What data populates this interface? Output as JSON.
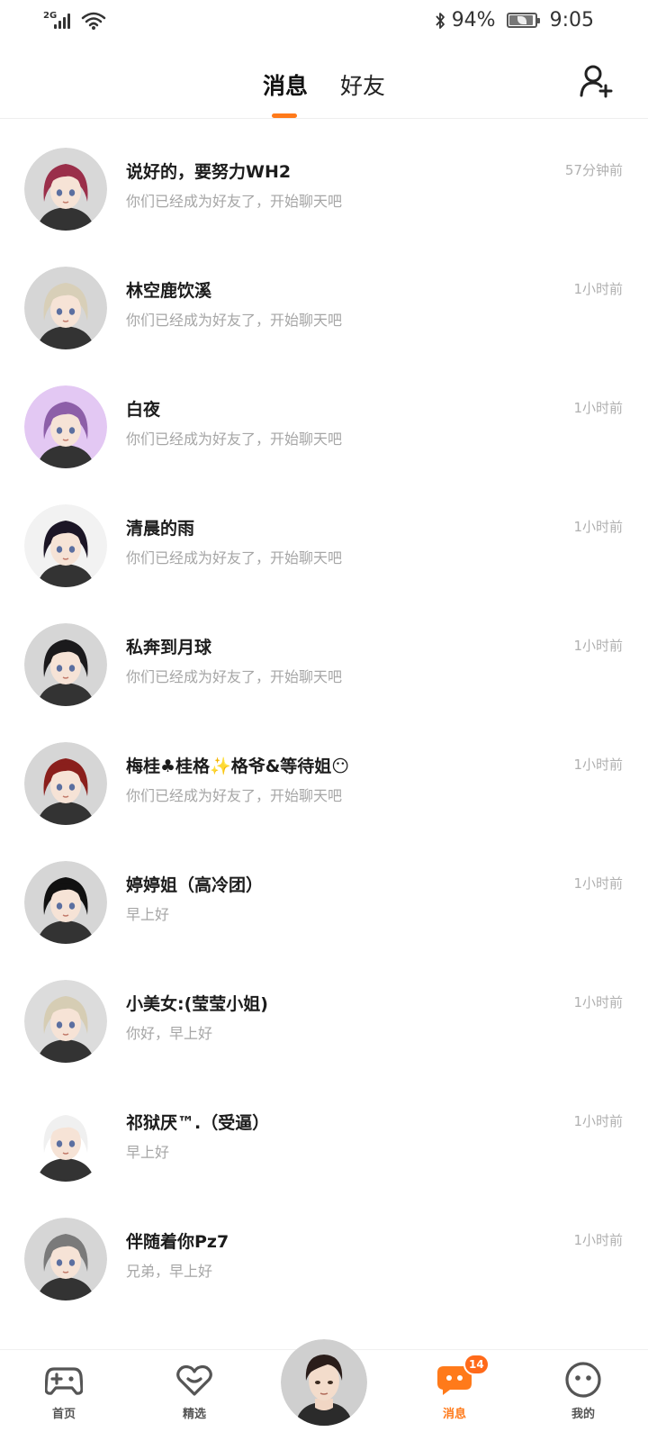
{
  "status_bar": {
    "network": "2G",
    "battery": "94%",
    "battery_level": 0.94,
    "time": "9:05"
  },
  "header": {
    "tabs": [
      {
        "label": "消息",
        "active": true
      },
      {
        "label": "好友",
        "active": false
      }
    ],
    "add_friend_icon": "add-user-icon",
    "accent_color": "#ff7a1a"
  },
  "conversations": [
    {
      "name": "",
      "preview": "",
      "time": "",
      "avatar_bg": "#f3d4d8"
    },
    {
      "name": "说好的，要努力WH2",
      "preview": "你们已经成为好友了，开始聊天吧",
      "time": "57分钟前",
      "avatar_bg": "#d8d8d8"
    },
    {
      "name": "林空鹿饮溪",
      "preview": "你们已经成为好友了，开始聊天吧",
      "time": "1小时前",
      "avatar_bg": "#d6d6d6"
    },
    {
      "name": "白夜",
      "preview": "你们已经成为好友了，开始聊天吧",
      "time": "1小时前",
      "avatar_bg": "#e3c8f3"
    },
    {
      "name": "清晨的雨",
      "preview": "你们已经成为好友了，开始聊天吧",
      "time": "1小时前",
      "avatar_bg": "#f2f2f2"
    },
    {
      "name": "私奔到月球",
      "preview": "你们已经成为好友了，开始聊天吧",
      "time": "1小时前",
      "avatar_bg": "#d6d6d6"
    },
    {
      "name": "梅桂♣桂格✨格爷&等待姐😶",
      "preview": "你们已经成为好友了，开始聊天吧",
      "time": "1小时前",
      "avatar_bg": "#d6d6d6"
    },
    {
      "name": "婷婷姐（高冷团）",
      "preview": "早上好",
      "time": "1小时前",
      "avatar_bg": "#d6d6d6"
    },
    {
      "name": "小美女:(莹莹小姐)",
      "preview": "你好，早上好",
      "time": "1小时前",
      "avatar_bg": "#dcdcdc"
    },
    {
      "name": "祁狱厌™.（受逼）",
      "preview": "早上好",
      "time": "1小时前",
      "avatar_bg": "#ffffff"
    },
    {
      "name": "伴随着你Pz7",
      "preview": "兄弟，早上好",
      "time": "1小时前",
      "avatar_bg": "#d6d6d6"
    }
  ],
  "bottom_nav": {
    "items": [
      {
        "label": "首页",
        "icon": "gamepad-icon",
        "active": false
      },
      {
        "label": "精选",
        "icon": "heart-icon",
        "active": false
      },
      {
        "label": "消息",
        "icon": "chat-bubble-icon",
        "active": true,
        "badge": "14"
      },
      {
        "label": "我的",
        "icon": "smiley-face-icon",
        "active": false
      }
    ],
    "center_avatar": "avatar"
  }
}
